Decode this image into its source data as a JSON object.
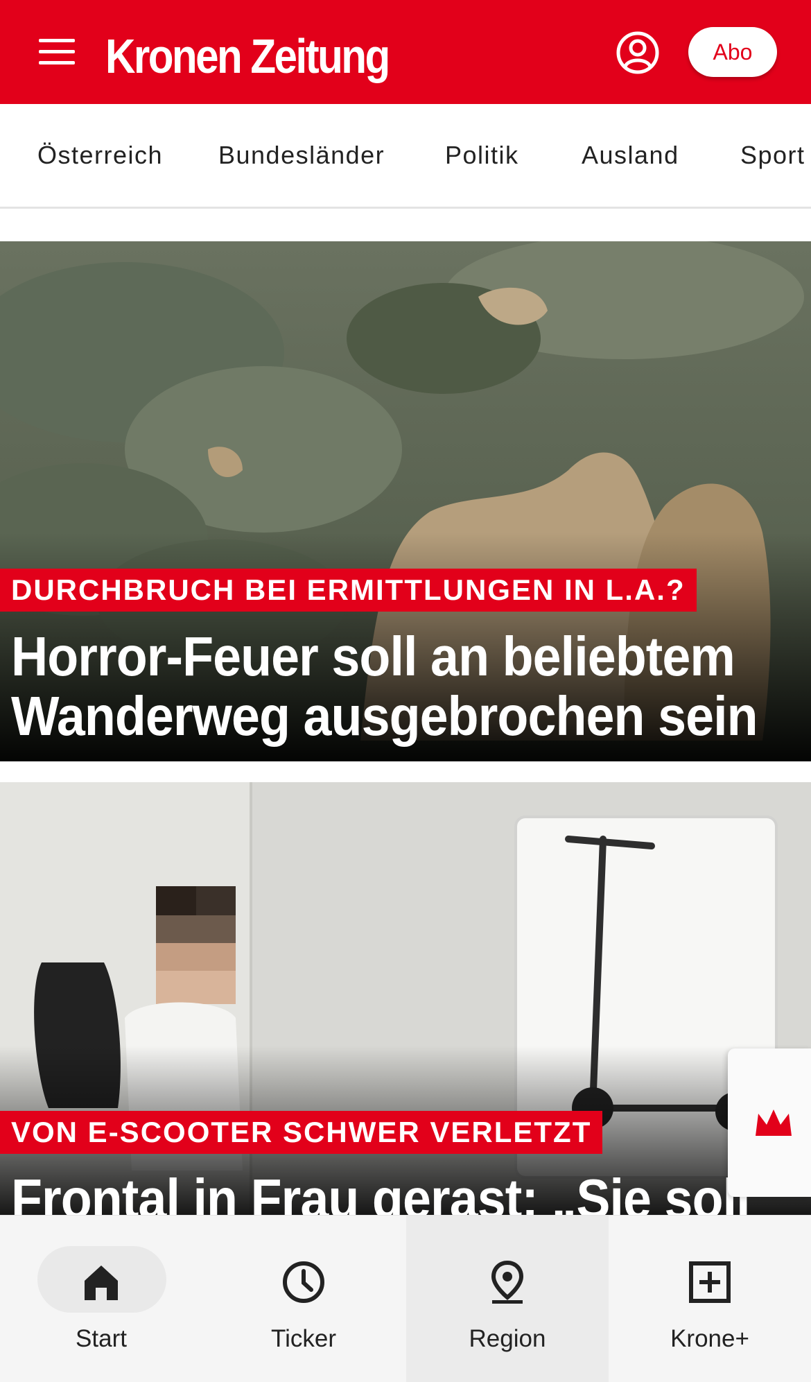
{
  "header": {
    "logo": "Kronen Zeitung",
    "abo_label": "Abo",
    "brand_color": "#e2001a",
    "icons": [
      "menu-icon",
      "account-icon"
    ]
  },
  "nav": {
    "items": [
      "Österreich",
      "Bundesländer",
      "Politik",
      "Ausland",
      "Sport"
    ]
  },
  "stories": [
    {
      "kicker": "DURCHBRUCH BEI ERMITTLUNGEN IN L.A.?",
      "headline_line1": "Horror-Feuer soll an beliebtem",
      "headline_line2": "Wanderweg ausgebrochen sein"
    },
    {
      "kicker": "VON E-SCOOTER SCHWER VERLETZT",
      "headline_line1": "Frontal in Frau gerast: „Sie soll"
    }
  ],
  "side_widget": {
    "icon": "crown-icon"
  },
  "bottom_nav": {
    "items": [
      {
        "label": "Start",
        "icon": "home-icon",
        "active": true
      },
      {
        "label": "Ticker",
        "icon": "clock-icon"
      },
      {
        "label": "Region",
        "icon": "location-pin-icon"
      },
      {
        "label": "Krone+",
        "icon": "plus-box-icon"
      }
    ]
  }
}
